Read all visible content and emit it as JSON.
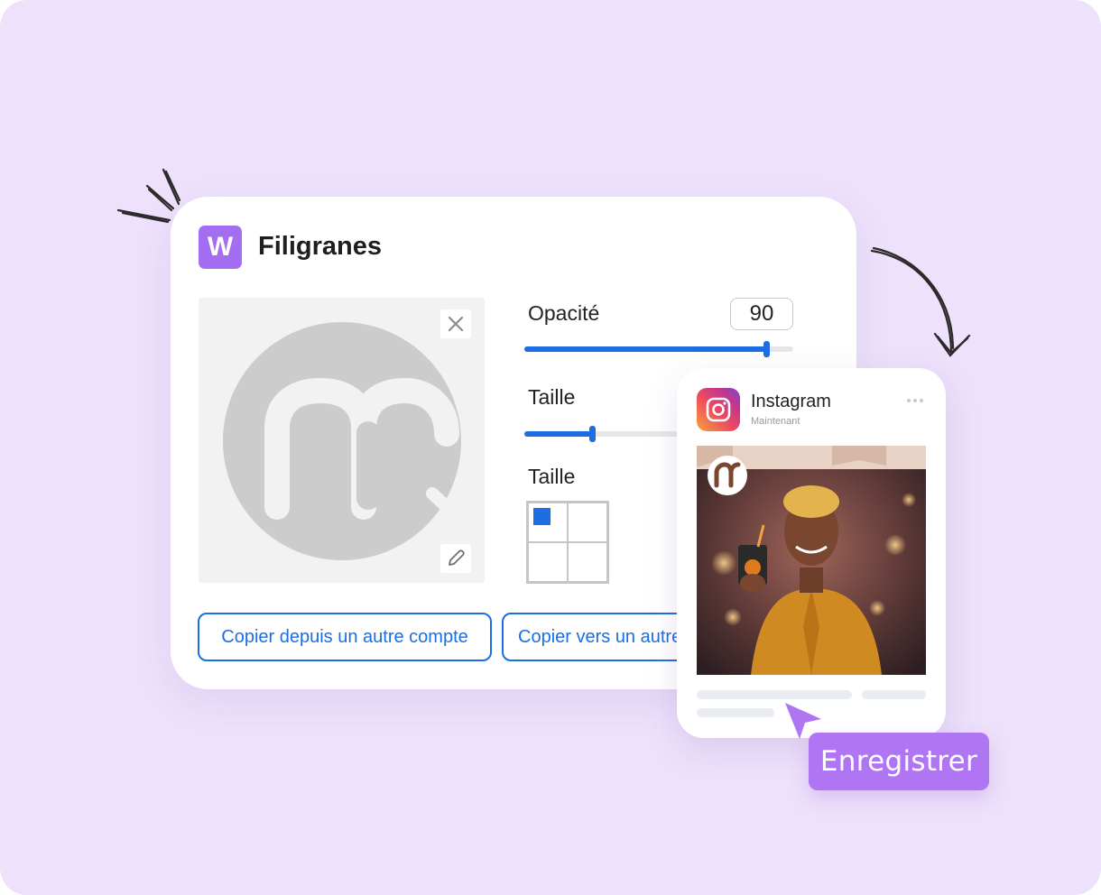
{
  "watermark_panel": {
    "app_icon_letter": "W",
    "title": "Filigranes",
    "preview_close_icon": "close-icon",
    "preview_edit_icon": "pencil-icon",
    "opacity_label": "Opacité",
    "opacity_value": "90",
    "opacity_level": 0.9,
    "size_label": "Taille",
    "size_level": 0.25,
    "position_label": "Taille",
    "position_selected": "top-left",
    "copy_from_label": "Copier depuis un autre compte",
    "copy_to_label": "Copier vers un autre compte"
  },
  "instagram_preview": {
    "network": "Instagram",
    "time": "Maintenant",
    "more_icon": "more-dots-icon"
  },
  "save_button_label": "Enregistrer",
  "colors": {
    "background": "#ede1fb",
    "accent_purple": "#a36ef2",
    "slider_blue": "#1b6fe3",
    "save_chip": "#b075f3"
  }
}
